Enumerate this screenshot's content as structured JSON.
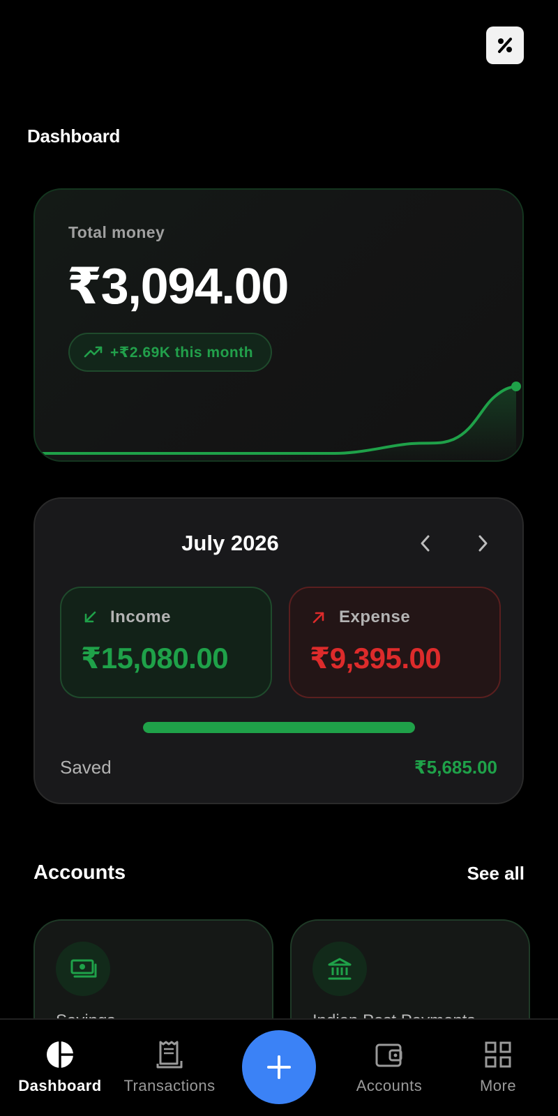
{
  "header": {
    "title": "Dashboard",
    "action_icon": "percent-icon"
  },
  "total_card": {
    "label": "Total money",
    "amount": "₹3,094.00",
    "trend_text": "+₹2.69K this month",
    "accent": "#22a04b"
  },
  "month_card": {
    "title": "July 2026",
    "income": {
      "label": "Income",
      "value": "₹15,080.00"
    },
    "expense": {
      "label": "Expense",
      "value": "₹9,395.00"
    },
    "saved_fraction": 1.0,
    "saved_label": "Saved",
    "saved_value": "₹5,685.00"
  },
  "accounts": {
    "heading": "Accounts",
    "see_all": "See all",
    "items": [
      {
        "icon": "cash-icon",
        "name": "Savings"
      },
      {
        "icon": "bank-icon",
        "name": "Indian Post Payments"
      }
    ]
  },
  "nav": {
    "items": [
      {
        "label": "Dashboard",
        "icon": "pie-chart-icon",
        "active": true
      },
      {
        "label": "Transactions",
        "icon": "receipt-icon",
        "active": false
      },
      {
        "label": "Accounts",
        "icon": "wallet-icon",
        "active": false
      },
      {
        "label": "More",
        "icon": "grid-icon",
        "active": false
      }
    ],
    "fab_icon": "plus-icon"
  },
  "colors": {
    "positive": "#1fa149",
    "negative": "#dd2b2b",
    "fab": "#3b82f6"
  }
}
